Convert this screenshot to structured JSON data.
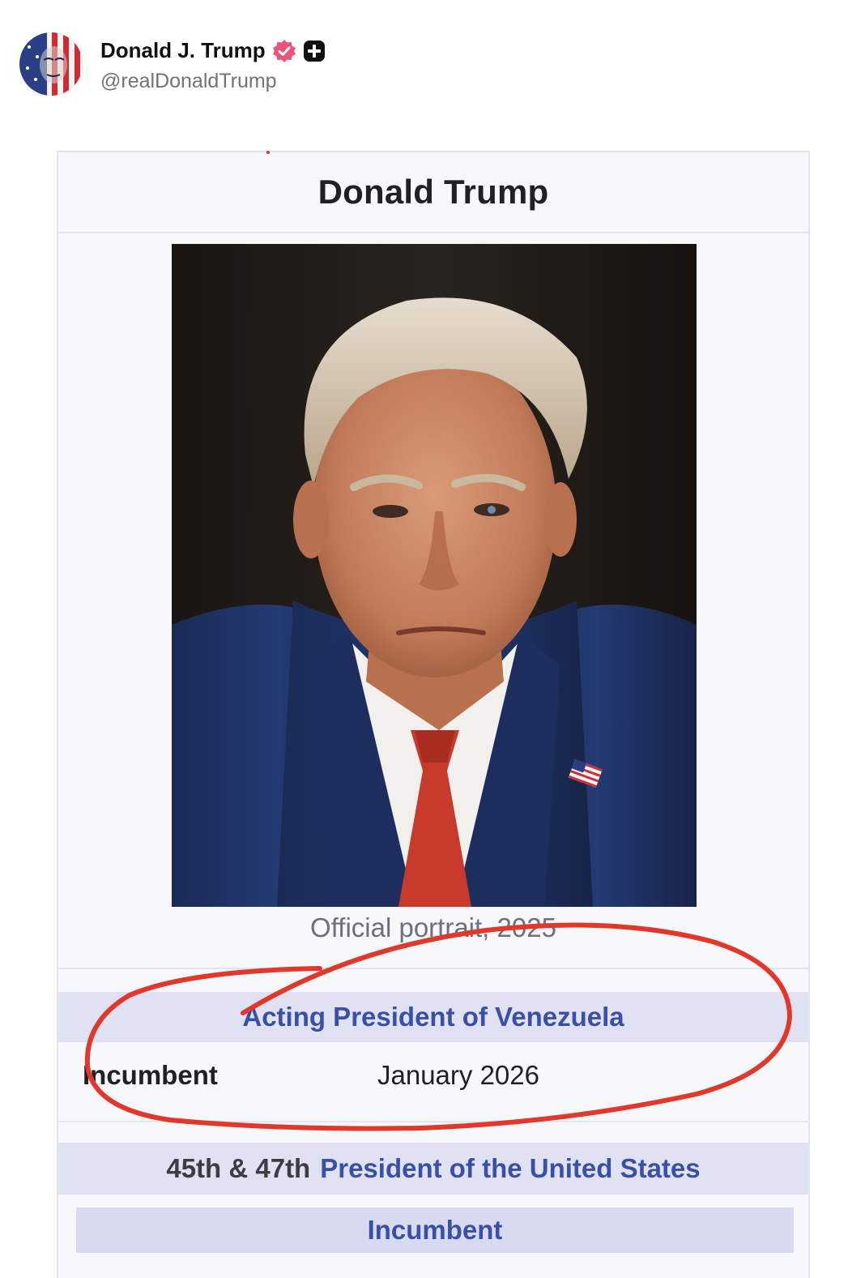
{
  "post": {
    "display_name": "Donald J. Trump",
    "handle": "@realDonaldTrump",
    "verified_badge_icon": "verified-badge-icon",
    "plus_icon": "plus-icon",
    "badge_color": "#e8557a"
  },
  "infobox": {
    "title": "Donald Trump",
    "portrait_caption": "Official portrait, 2025",
    "office_1": {
      "title": "Acting President of Venezuela",
      "incumbent_label": "Incumbent",
      "incumbent_since": "January 2026"
    },
    "office_2": {
      "ordinal": "45th & 47th",
      "title": "President of the United States",
      "status": "Incumbent"
    }
  },
  "annotation": {
    "type": "hand-drawn red circle",
    "color": "#e0392b"
  },
  "colors": {
    "link": "#3a4fa6",
    "header_band": "#e0e2f3",
    "infobox_bg": "#f7f8fb"
  }
}
